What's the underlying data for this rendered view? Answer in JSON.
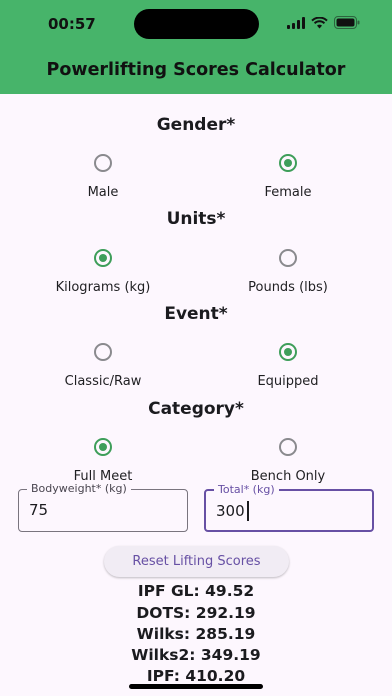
{
  "status_bar": {
    "time": "00:57"
  },
  "app_bar": {
    "title": "Powerlifting Scores Calculator"
  },
  "gender": {
    "title": "Gender*",
    "options": [
      {
        "label": "Male",
        "selected": false
      },
      {
        "label": "Female",
        "selected": true
      }
    ]
  },
  "units": {
    "title": "Units*",
    "options": [
      {
        "label": "Kilograms (kg)",
        "selected": true
      },
      {
        "label": "Pounds (lbs)",
        "selected": false
      }
    ]
  },
  "event": {
    "title": "Event*",
    "options": [
      {
        "label": "Classic/Raw",
        "selected": false
      },
      {
        "label": "Equipped",
        "selected": true
      }
    ]
  },
  "category": {
    "title": "Category*",
    "options": [
      {
        "label": "Full Meet",
        "selected": true
      },
      {
        "label": "Bench Only",
        "selected": false
      }
    ]
  },
  "bodyweight": {
    "label": "Bodyweight* (kg)",
    "value": "75"
  },
  "total": {
    "label": "Total* (kg)",
    "value": "300"
  },
  "reset_button": {
    "label": "Reset Lifting Scores"
  },
  "scores": {
    "ipf_gl": "IPF GL: 49.52",
    "dots": "DOTS: 292.19",
    "wilks": "Wilks: 285.19",
    "wilks2": "Wilks2: 349.19",
    "ipf": "IPF: 410.20"
  },
  "colors": {
    "app_bar": "#47b46a",
    "radio_selected": "#3e9e5a",
    "accent": "#6750a4",
    "background": "#fdf7fe"
  }
}
